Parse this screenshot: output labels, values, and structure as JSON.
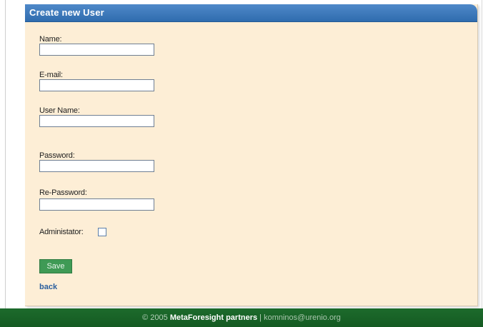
{
  "form": {
    "title": "Create new User",
    "fields": {
      "name": {
        "label": "Name:",
        "value": ""
      },
      "email": {
        "label": "E-mail:",
        "value": ""
      },
      "username": {
        "label": "User Name:",
        "value": ""
      },
      "password": {
        "label": "Password:",
        "value": ""
      },
      "repassword": {
        "label": "Re-Password:",
        "value": ""
      }
    },
    "admin": {
      "label": "Administator:",
      "checked": false
    },
    "save_label": "Save",
    "back_label": "back"
  },
  "footer": {
    "copyright": "© 2005",
    "org": "MetaForesight partners",
    "separator": "|",
    "email": "komninos@urenio.org"
  },
  "colors": {
    "header_blue": "#2f6cae",
    "panel_bg": "#fdeed6",
    "save_green": "#3f9a55",
    "footer_green": "#145a22",
    "link_blue": "#2a5f9e"
  }
}
